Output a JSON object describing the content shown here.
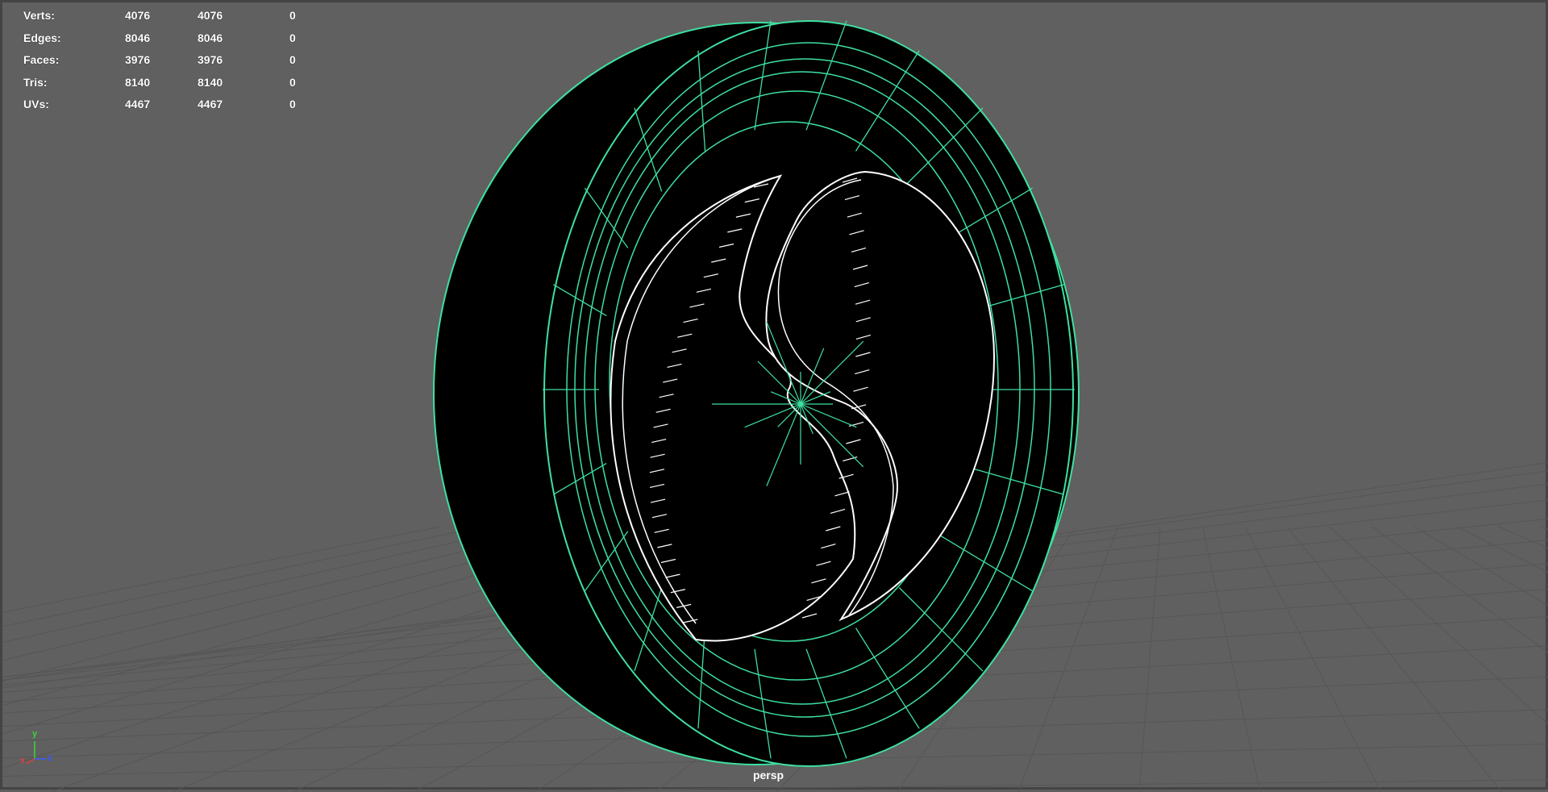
{
  "hud": {
    "rows": [
      {
        "label": "Verts:",
        "v1": "4076",
        "v2": "4076",
        "v3": "0"
      },
      {
        "label": "Edges:",
        "v1": "8046",
        "v2": "8046",
        "v3": "0"
      },
      {
        "label": "Faces:",
        "v1": "3976",
        "v2": "3976",
        "v3": "0"
      },
      {
        "label": "Tris:",
        "v1": "8140",
        "v2": "8140",
        "v3": "0"
      },
      {
        "label": "UVs:",
        "v1": "4467",
        "v2": "4467",
        "v3": "0"
      }
    ]
  },
  "camera": "persp",
  "axis": {
    "x": "x",
    "y": "y",
    "z": "z"
  },
  "colors": {
    "background": "#606060",
    "grid": "#555555",
    "wire_green": "#3ee0a0",
    "wire_white": "#ffffff",
    "solid": "#000000"
  }
}
